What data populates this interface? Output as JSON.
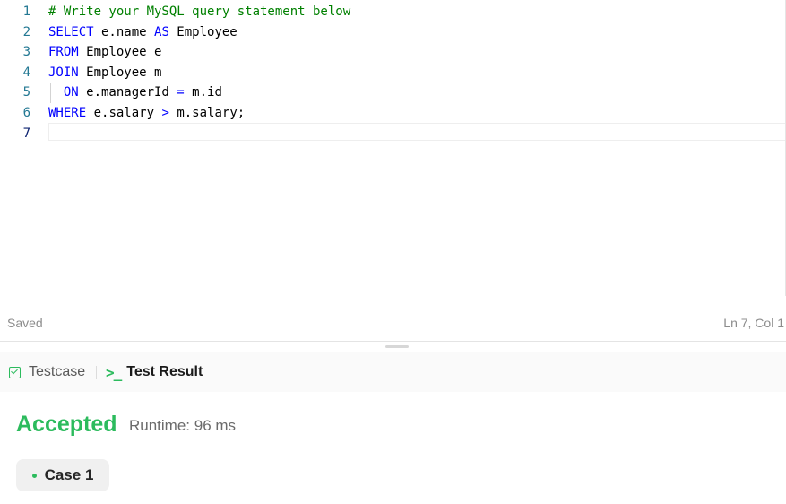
{
  "editor": {
    "lines": [
      {
        "number": "1",
        "tokens": [
          {
            "text": "# Write your MySQL query statement below",
            "cls": "cm"
          }
        ]
      },
      {
        "number": "2",
        "tokens": [
          {
            "text": "SELECT",
            "cls": "kw"
          },
          {
            "text": " e.name ",
            "cls": ""
          },
          {
            "text": "AS",
            "cls": "kw"
          },
          {
            "text": " Employee",
            "cls": ""
          }
        ]
      },
      {
        "number": "3",
        "tokens": [
          {
            "text": "FROM",
            "cls": "kw"
          },
          {
            "text": " Employee e",
            "cls": ""
          }
        ]
      },
      {
        "number": "4",
        "tokens": [
          {
            "text": "JOIN",
            "cls": "kw"
          },
          {
            "text": " Employee m",
            "cls": ""
          }
        ]
      },
      {
        "number": "5",
        "tokens": [
          {
            "text": "  ",
            "cls": ""
          },
          {
            "text": "ON",
            "cls": "kw"
          },
          {
            "text": " e.managerId ",
            "cls": ""
          },
          {
            "text": "=",
            "cls": "kw"
          },
          {
            "text": " m.id",
            "cls": ""
          }
        ]
      },
      {
        "number": "6",
        "tokens": [
          {
            "text": "WHERE",
            "cls": "kw"
          },
          {
            "text": " e.salary ",
            "cls": ""
          },
          {
            "text": ">",
            "cls": "kw"
          },
          {
            "text": " m.salary;",
            "cls": ""
          }
        ]
      },
      {
        "number": "7",
        "tokens": []
      }
    ]
  },
  "status": {
    "saved": "Saved",
    "cursor_position": "Ln 7, Col 1"
  },
  "tabs": {
    "testcase_label": "Testcase",
    "result_label": "Test Result",
    "testcase_icon": "checkbox-icon",
    "result_icon": "terminal-icon"
  },
  "result": {
    "status": "Accepted",
    "runtime": "Runtime: 96 ms",
    "case_label": "Case 1"
  },
  "colors": {
    "accent_green": "#2cbb5d",
    "keyword": "#0000ff",
    "comment": "#008000",
    "line_number": "#237893"
  }
}
